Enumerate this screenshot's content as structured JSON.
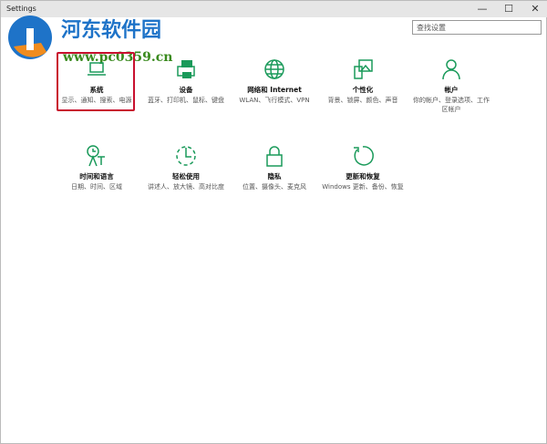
{
  "window": {
    "title": "Settings",
    "minimize": "—",
    "maximize": "☐",
    "close": "✕"
  },
  "search": {
    "placeholder": "查找设置"
  },
  "watermark": {
    "name": "河东软件园",
    "url": "www.pc0359.cn"
  },
  "accent": "#1a9a5a",
  "items": [
    {
      "name": "系统",
      "desc": "显示、通知、搜索、电源",
      "icon": "laptop-icon"
    },
    {
      "name": "设备",
      "desc": "蓝牙、打印机、鼠标、键盘",
      "icon": "printer-icon"
    },
    {
      "name": "网络和 Internet",
      "desc": "WLAN、飞行模式、VPN",
      "icon": "globe-icon"
    },
    {
      "name": "个性化",
      "desc": "背景、锁屏、颜色、声音",
      "icon": "personalization-icon"
    },
    {
      "name": "帐户",
      "desc": "你的帐户、登录选项、工作区帐户",
      "icon": "person-icon"
    },
    {
      "name": "时间和语言",
      "desc": "日期、时间、区域",
      "icon": "time-language-icon"
    },
    {
      "name": "轻松使用",
      "desc": "讲述人、放大镜、高对比度",
      "icon": "ease-of-access-icon"
    },
    {
      "name": "隐私",
      "desc": "位置、摄像头、麦克风",
      "icon": "lock-icon"
    },
    {
      "name": "更新和恢复",
      "desc": "Windows 更新、备份、恢复",
      "icon": "update-icon"
    }
  ]
}
